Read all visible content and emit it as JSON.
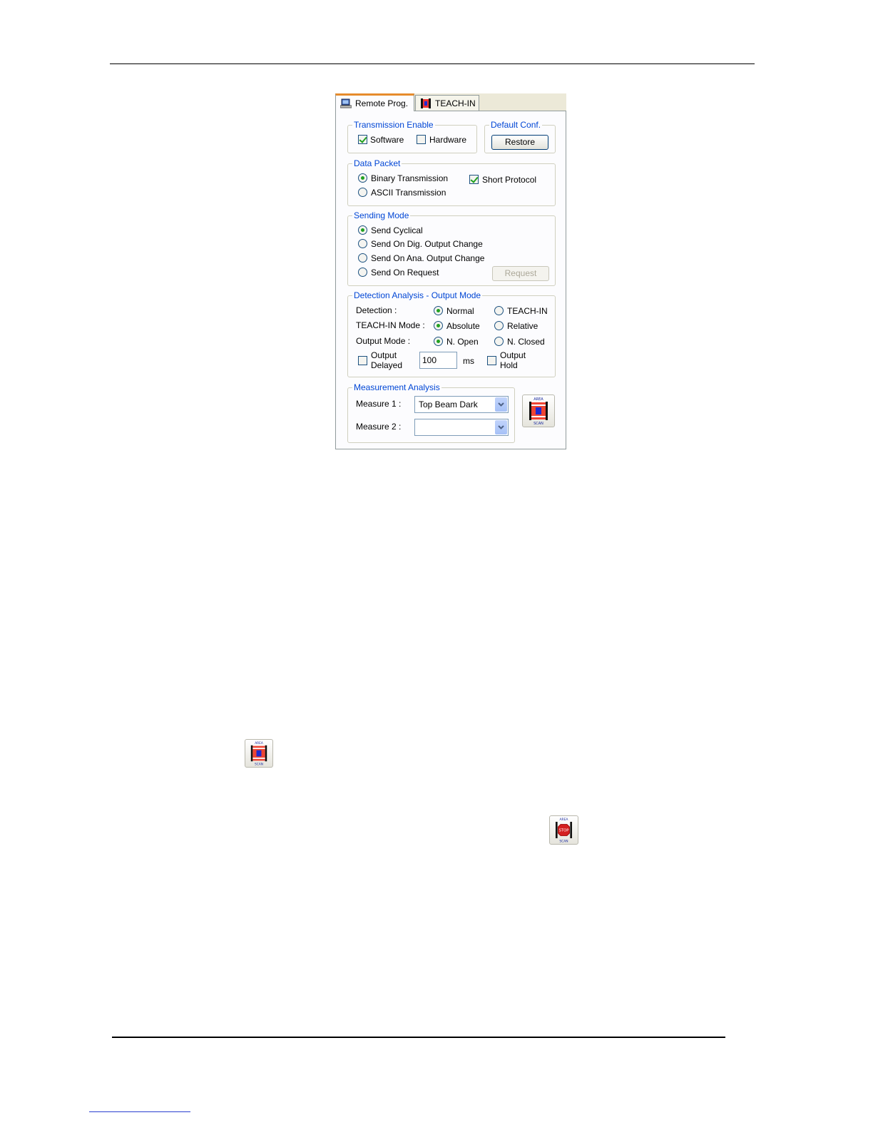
{
  "tabs": [
    {
      "label": "Remote Prog.",
      "icon": "computer-icon",
      "active": true
    },
    {
      "label": "TEACH-IN",
      "icon": "area-scan-icon",
      "active": false
    }
  ],
  "transmission_enable": {
    "title": "Transmission Enable",
    "software_label": "Software",
    "software_checked": true,
    "hardware_label": "Hardware",
    "hardware_checked": false
  },
  "default_conf": {
    "title": "Default Conf.",
    "restore_label": "Restore"
  },
  "data_packet": {
    "title": "Data Packet",
    "binary_label": "Binary Transmission",
    "ascii_label": "ASCII Transmission",
    "selected": "Binary Transmission",
    "short_protocol_label": "Short Protocol",
    "short_protocol_checked": true
  },
  "sending_mode": {
    "title": "Sending Mode",
    "options": [
      "Send Cyclical",
      "Send On Dig. Output Change",
      "Send On Ana. Output Change",
      "Send On Request"
    ],
    "selected": "Send Cyclical",
    "request_label": "Request"
  },
  "detection_analysis": {
    "title": "Detection Analysis - Output Mode",
    "detection_label": "Detection :",
    "detection_normal": "Normal",
    "detection_teachin": "TEACH-IN",
    "teachin_mode_label": "TEACH-IN Mode :",
    "teachin_absolute": "Absolute",
    "teachin_relative": "Relative",
    "output_mode_label": "Output Mode :",
    "output_open": "N. Open",
    "output_closed": "N. Closed",
    "output_delayed_line1": "Output",
    "output_delayed_line2": "Delayed",
    "delay_value": "100",
    "delay_unit": "ms",
    "output_hold_line1": "Output",
    "output_hold_line2": "Hold"
  },
  "measurement_analysis": {
    "title": "Measurement Analysis",
    "measure1_label": "Measure 1 :",
    "measure1_value": "Top Beam Dark",
    "measure2_label": "Measure 2 :",
    "measure2_value": ""
  },
  "icons": {
    "start_scan": "area-scan-icon",
    "inline_start_scan": "area-scan-icon",
    "inline_stop_scan": "area-scan-stop-icon"
  },
  "colors": {
    "group_title": "#0046d5",
    "tab_accent": "#e68b2c",
    "check_mark": "#21a121"
  }
}
